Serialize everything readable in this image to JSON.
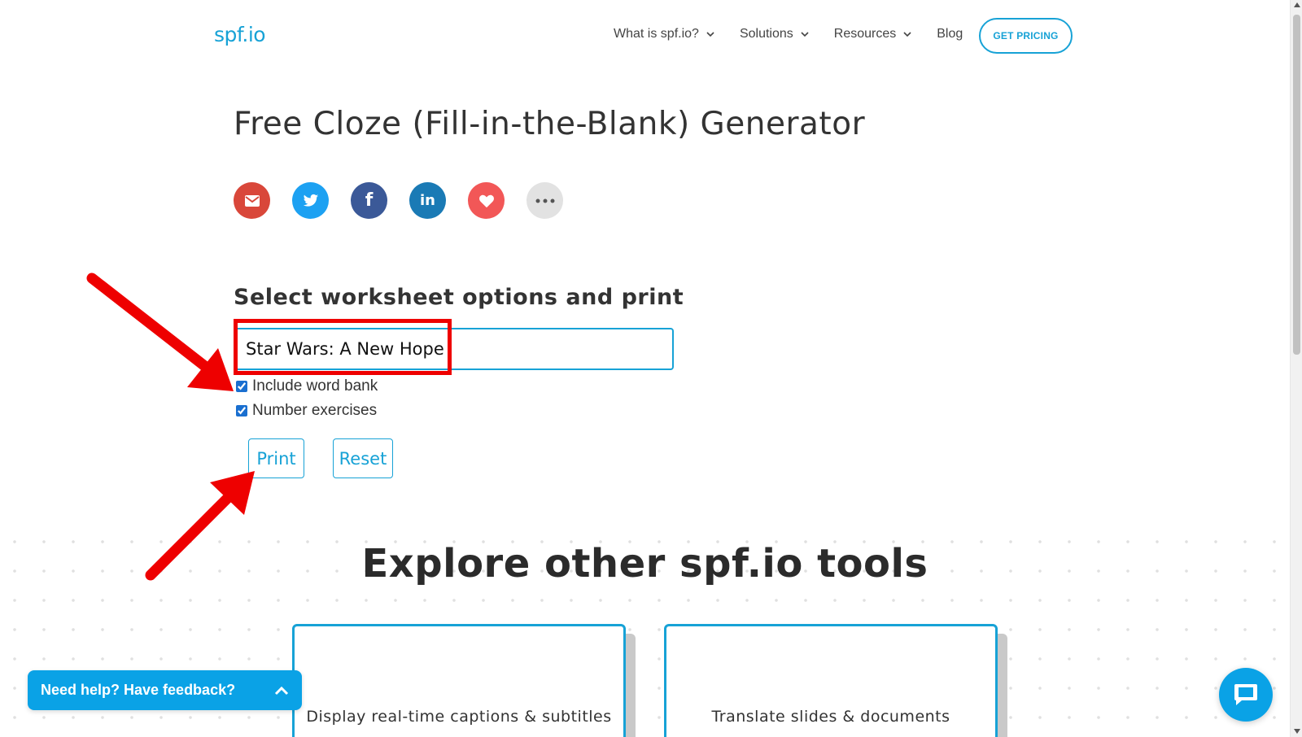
{
  "header": {
    "logo_text": "spf.io",
    "nav": [
      {
        "label": "What is spf.io?",
        "has_dropdown": true
      },
      {
        "label": "Solutions",
        "has_dropdown": true
      },
      {
        "label": "Resources",
        "has_dropdown": true
      },
      {
        "label": "Blog",
        "has_dropdown": false
      }
    ],
    "pricing_button": "GET PRICING"
  },
  "page_title": "Free Cloze (Fill-in-the-Blank) Generator",
  "share_icons": [
    "email-icon",
    "twitter-icon",
    "facebook-icon",
    "linkedin-icon",
    "heart-icon",
    "more-icon"
  ],
  "options": {
    "section_title": "Select worksheet options and print",
    "title_value": "Star Wars: A New Hope",
    "include_word_bank_label": "Include word bank",
    "include_word_bank_checked": true,
    "number_exercises_label": "Number exercises",
    "number_exercises_checked": true,
    "print_label": "Print",
    "reset_label": "Reset"
  },
  "explore": {
    "title": "Explore other spf.io tools",
    "cards": [
      {
        "text": "Display real-time captions & subtitles"
      },
      {
        "text": "Translate slides & documents"
      }
    ]
  },
  "widgets": {
    "feedback_label": "Need help? Have feedback?"
  },
  "colors": {
    "accent": "#17a2d6",
    "annotation_red": "#e00000",
    "feedback_bg": "#0aa2e6"
  }
}
